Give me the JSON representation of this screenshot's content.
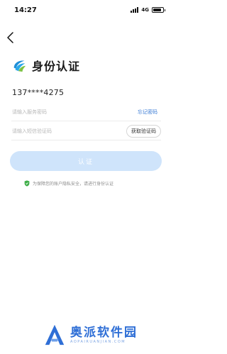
{
  "status_bar": {
    "time": "14:27",
    "network": "4G",
    "battery_level": 0.85
  },
  "header": {
    "title": "身份认证"
  },
  "account": {
    "phone": "137****4275"
  },
  "password_field": {
    "placeholder": "请输入服务密码",
    "forgot_label": "忘记密码"
  },
  "sms_field": {
    "placeholder": "请输入短信验证码",
    "get_code_label": "获取验证码"
  },
  "confirm_button": {
    "label": "认证"
  },
  "security_note": {
    "text": "为保障您的账户隐私安全，请进行身份认证"
  },
  "watermark": {
    "title": "奥派软件园",
    "subtitle": "AOPAIRUANJIAN.COM"
  },
  "colors": {
    "accent": "#3a7bd5",
    "button_disabled": "#cfe4fb",
    "shield": "#3fae49"
  }
}
